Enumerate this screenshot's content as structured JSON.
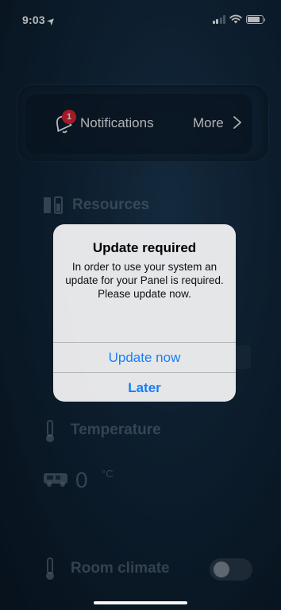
{
  "status_bar": {
    "time": "9:03"
  },
  "notifications": {
    "label": "Notifications",
    "badge_count": "1",
    "more_label": "More"
  },
  "sections": {
    "resources": {
      "title": "Resources"
    },
    "temperature": {
      "title": "Temperature",
      "value": "0",
      "unit": "°C"
    },
    "room_climate": {
      "title": "Room climate",
      "toggle_on": false
    }
  },
  "alert": {
    "title": "Update required",
    "message": "In order to use your system an update for your Panel is required. Please update now.",
    "primary_button": "Update now",
    "secondary_button": "Later"
  },
  "colors": {
    "accent": "#1a7ef5",
    "badge": "#e3243b",
    "alert_bg": "#ececee"
  }
}
